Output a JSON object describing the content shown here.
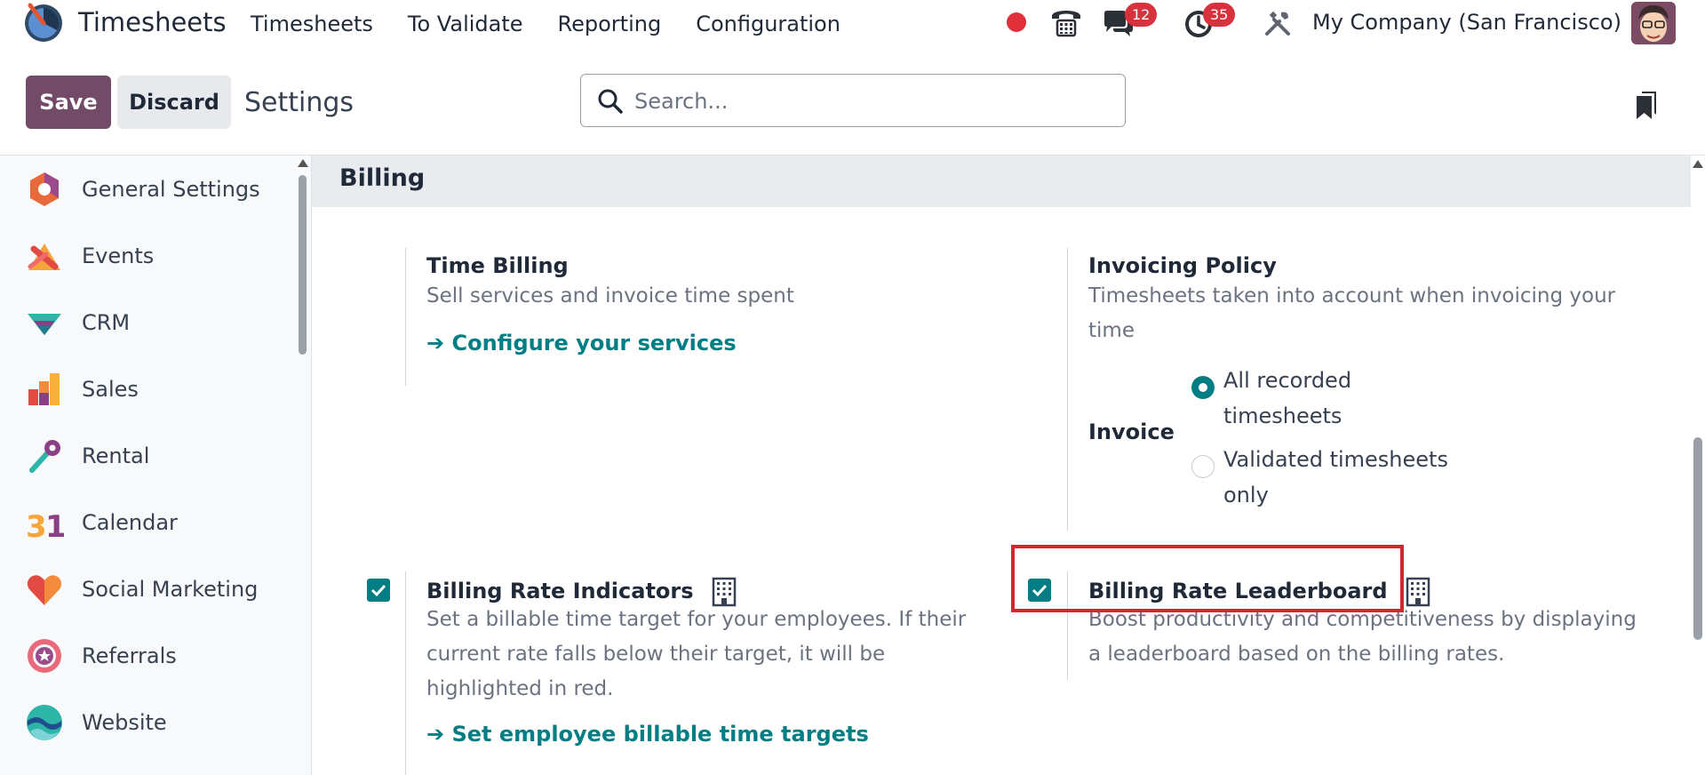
{
  "app": {
    "title": "Timesheets"
  },
  "nav": {
    "items": [
      {
        "label": "Timesheets"
      },
      {
        "label": "To Validate"
      },
      {
        "label": "Reporting"
      },
      {
        "label": "Configuration"
      }
    ]
  },
  "systray": {
    "chat_count": "12",
    "activity_count": "35",
    "company": "My Company (San Francisco)"
  },
  "control_panel": {
    "save_label": "Save",
    "discard_label": "Discard",
    "title": "Settings",
    "search_placeholder": "Search..."
  },
  "sidebar": {
    "items": [
      {
        "label": "General Settings",
        "icon": "general-settings-icon"
      },
      {
        "label": "Events",
        "icon": "events-icon"
      },
      {
        "label": "CRM",
        "icon": "crm-icon"
      },
      {
        "label": "Sales",
        "icon": "sales-icon"
      },
      {
        "label": "Rental",
        "icon": "rental-icon"
      },
      {
        "label": "Calendar",
        "icon": "calendar-icon"
      },
      {
        "label": "Social Marketing",
        "icon": "social-marketing-icon"
      },
      {
        "label": "Referrals",
        "icon": "referrals-icon"
      },
      {
        "label": "Website",
        "icon": "website-icon"
      }
    ]
  },
  "billing": {
    "section_title": "Billing",
    "time_billing": {
      "title": "Time Billing",
      "description": "Sell services and invoice time spent",
      "link": "Configure your services"
    },
    "invoicing_policy": {
      "title": "Invoicing Policy",
      "description": "Timesheets taken into account when invoicing your time",
      "invoice_label": "Invoice",
      "options": [
        {
          "label": "All recorded timesheets",
          "selected": true
        },
        {
          "label": "Validated timesheets only",
          "selected": false
        }
      ]
    },
    "billing_rate_indicators": {
      "title": "Billing Rate Indicators",
      "checked": true,
      "description": "Set a billable time target for your employees. If their current rate falls below their target, it will be highlighted in red.",
      "link": "Set employee billable time targets"
    },
    "billing_rate_leaderboard": {
      "title": "Billing Rate Leaderboard",
      "checked": true,
      "description": "Boost productivity and competitiveness by displaying a leaderboard based on the billing rates."
    }
  },
  "colors": {
    "brand": "#714b67",
    "accent": "#017e84",
    "badge": "#d9323f",
    "highlight": "#d22630"
  }
}
